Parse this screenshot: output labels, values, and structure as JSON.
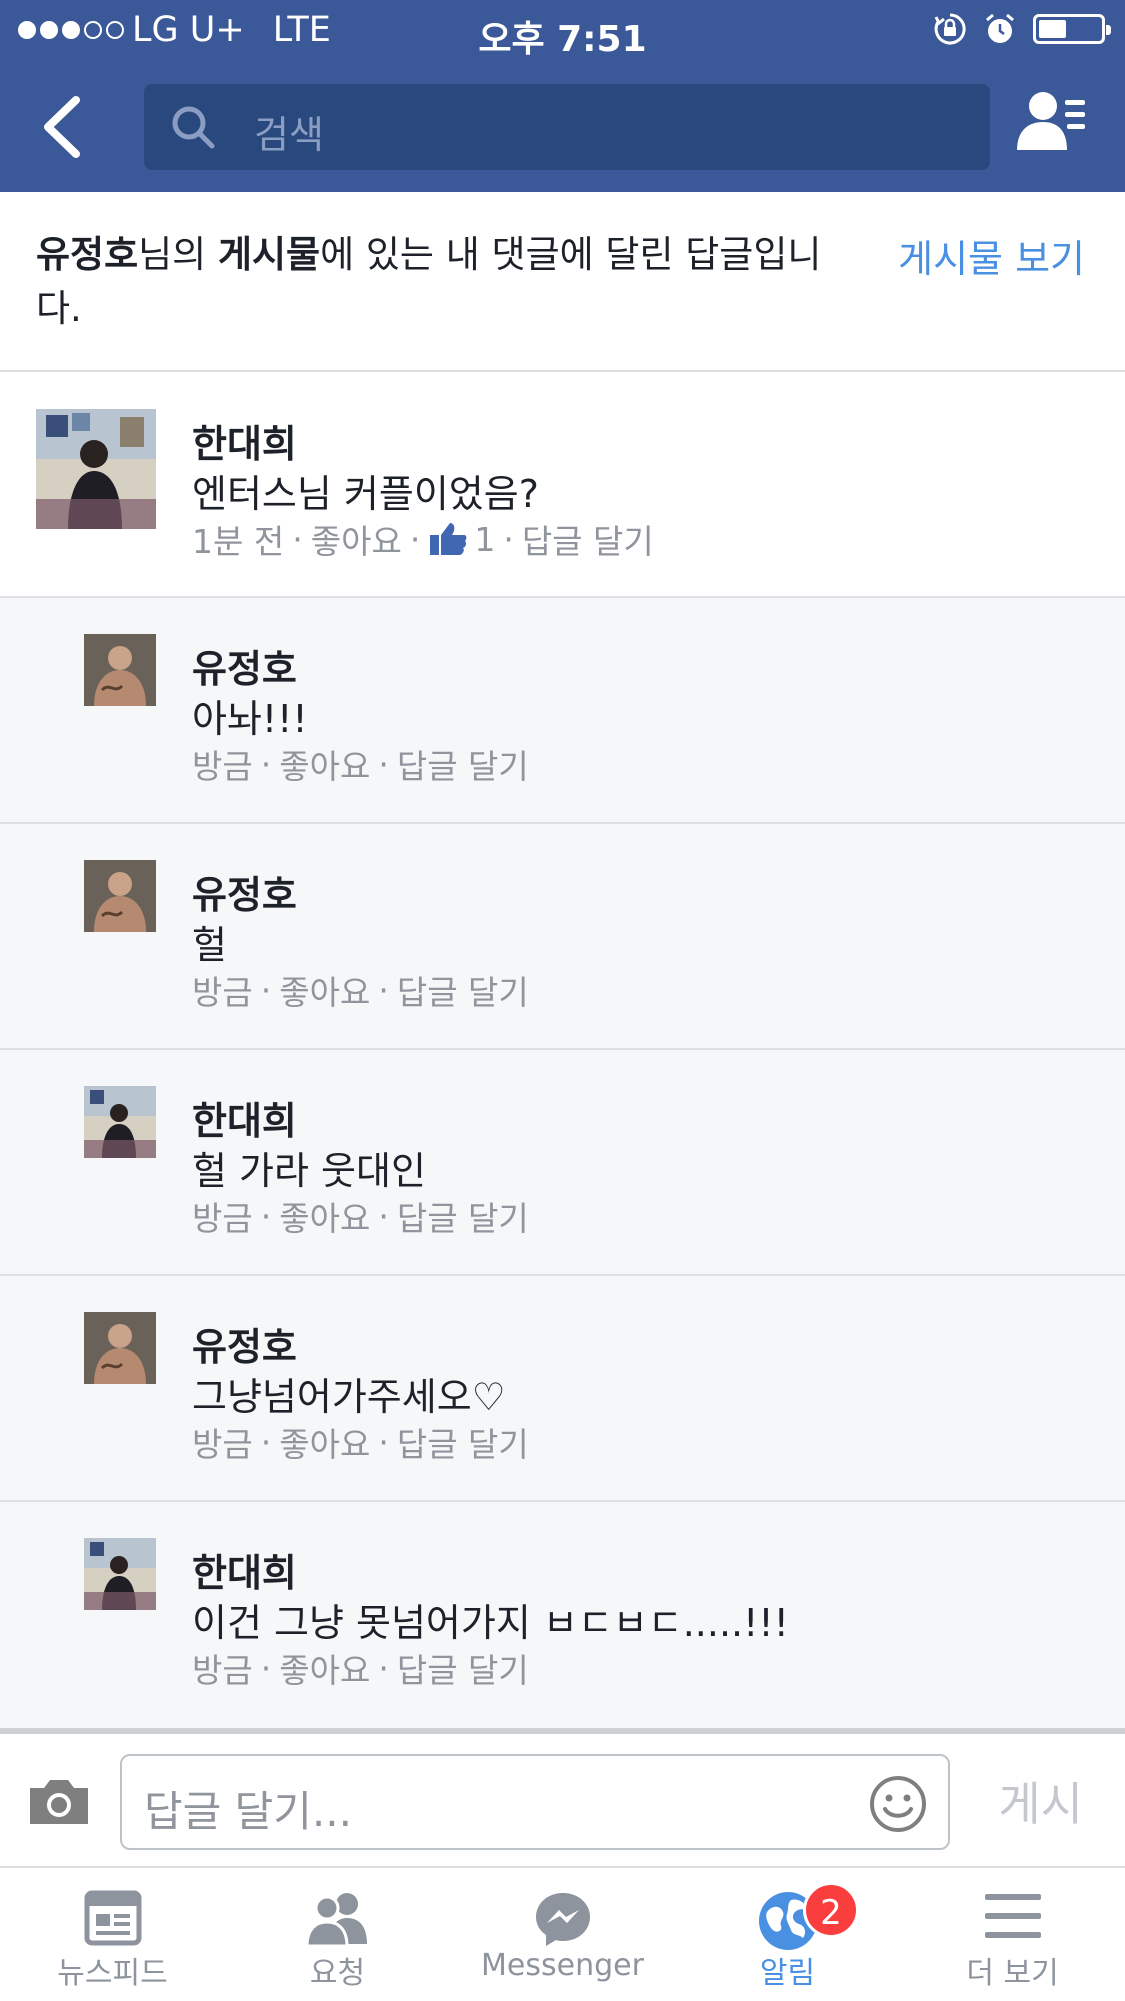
{
  "status_bar": {
    "carrier": "LG U+",
    "network": "LTE",
    "time": "오후 7:51",
    "signal_bars": 3,
    "battery_level": 0.45
  },
  "nav": {
    "search_placeholder": "검색",
    "icons": [
      "back-icon",
      "search-icon",
      "friend-requests-icon"
    ]
  },
  "context": {
    "author": "유정호",
    "part1": "님의 ",
    "post_word": "게시물",
    "part2": "에 있는 내 댓글에 달린 답글입니다.",
    "view_post": "게시물 보기"
  },
  "comments": [
    {
      "name": "한대희",
      "text": "엔터스님 커플이었음?",
      "time": "1분 전",
      "like": "좋아요",
      "like_count": "1",
      "reply": "답글 달기"
    },
    {
      "name": "유정호",
      "text": "아놔!!!",
      "time": "방금",
      "like": "좋아요",
      "reply": "답글 달기"
    },
    {
      "name": "유정호",
      "text": "헐",
      "time": "방금",
      "like": "좋아요",
      "reply": "답글 달기"
    },
    {
      "name": "한대희",
      "text": "헐 가라 웃대인",
      "time": "방금",
      "like": "좋아요",
      "reply": "답글 달기"
    },
    {
      "name": "유정호",
      "text": "그냥넘어가주세오♡",
      "time": "방금",
      "like": "좋아요",
      "reply": "답글 달기"
    },
    {
      "name": "한대희",
      "text": "이건 그냥 못넘어가지 ㅂㄷㅂㄷ.....!!!",
      "time": "방금",
      "like": "좋아요",
      "reply": "답글 달기"
    }
  ],
  "composer": {
    "placeholder": "답글 달기...",
    "post_label": "게시"
  },
  "tabs": [
    {
      "label": "뉴스피드",
      "icon": "news-feed-icon"
    },
    {
      "label": "요청",
      "icon": "friend-requests-icon"
    },
    {
      "label": "Messenger",
      "icon": "messenger-icon"
    },
    {
      "label": "알림",
      "icon": "globe-notifications-icon",
      "badge": "2",
      "active": true
    },
    {
      "label": "더 보기",
      "icon": "menu-icon"
    }
  ],
  "colors": {
    "header": "#3b5998",
    "link": "#4a90e2",
    "badge": "#fa3e3e"
  }
}
